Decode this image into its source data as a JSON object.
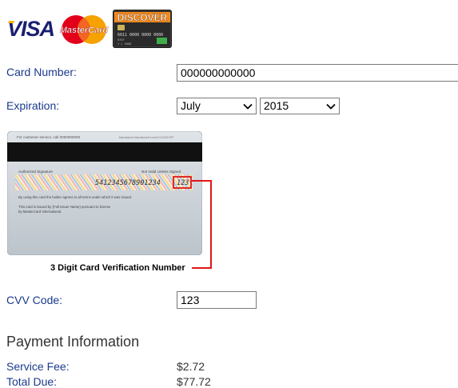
{
  "logos": {
    "visa": "VISA",
    "mastercard": "MasterCard",
    "discover": "DISCOVER"
  },
  "form": {
    "card_number_label": "Card Number:",
    "card_number_value": "000000000000",
    "expiration_label": "Expiration:",
    "exp_month": "July",
    "exp_year": "2015",
    "cvv_caption": "3 Digit Card Verification Number",
    "cvv_label": "CVV Code:",
    "cvv_value": "123"
  },
  "card_back": {
    "service_text": "For customer service, call 0000000000",
    "signature_label": "Authorized Signature",
    "not_valid": "Not Valid Unless Signed",
    "signature_number": "5412345678901234",
    "cvv_digits": "123",
    "terms_line": "By using this card the holder agrees to all terms under which it was issued.",
    "issued_line1": "This card is issued by (Full Issuer Name) pursuant to license",
    "issued_line2": "by MasterCard International."
  },
  "payment": {
    "title": "Payment Information",
    "service_fee_label": "Service Fee:",
    "service_fee_value": "$2.72",
    "total_due_label": "Total Due:",
    "total_due_value": "$77.72"
  },
  "colors": {
    "label_blue": "#1a3a8c",
    "callout_red": "#e01818"
  }
}
